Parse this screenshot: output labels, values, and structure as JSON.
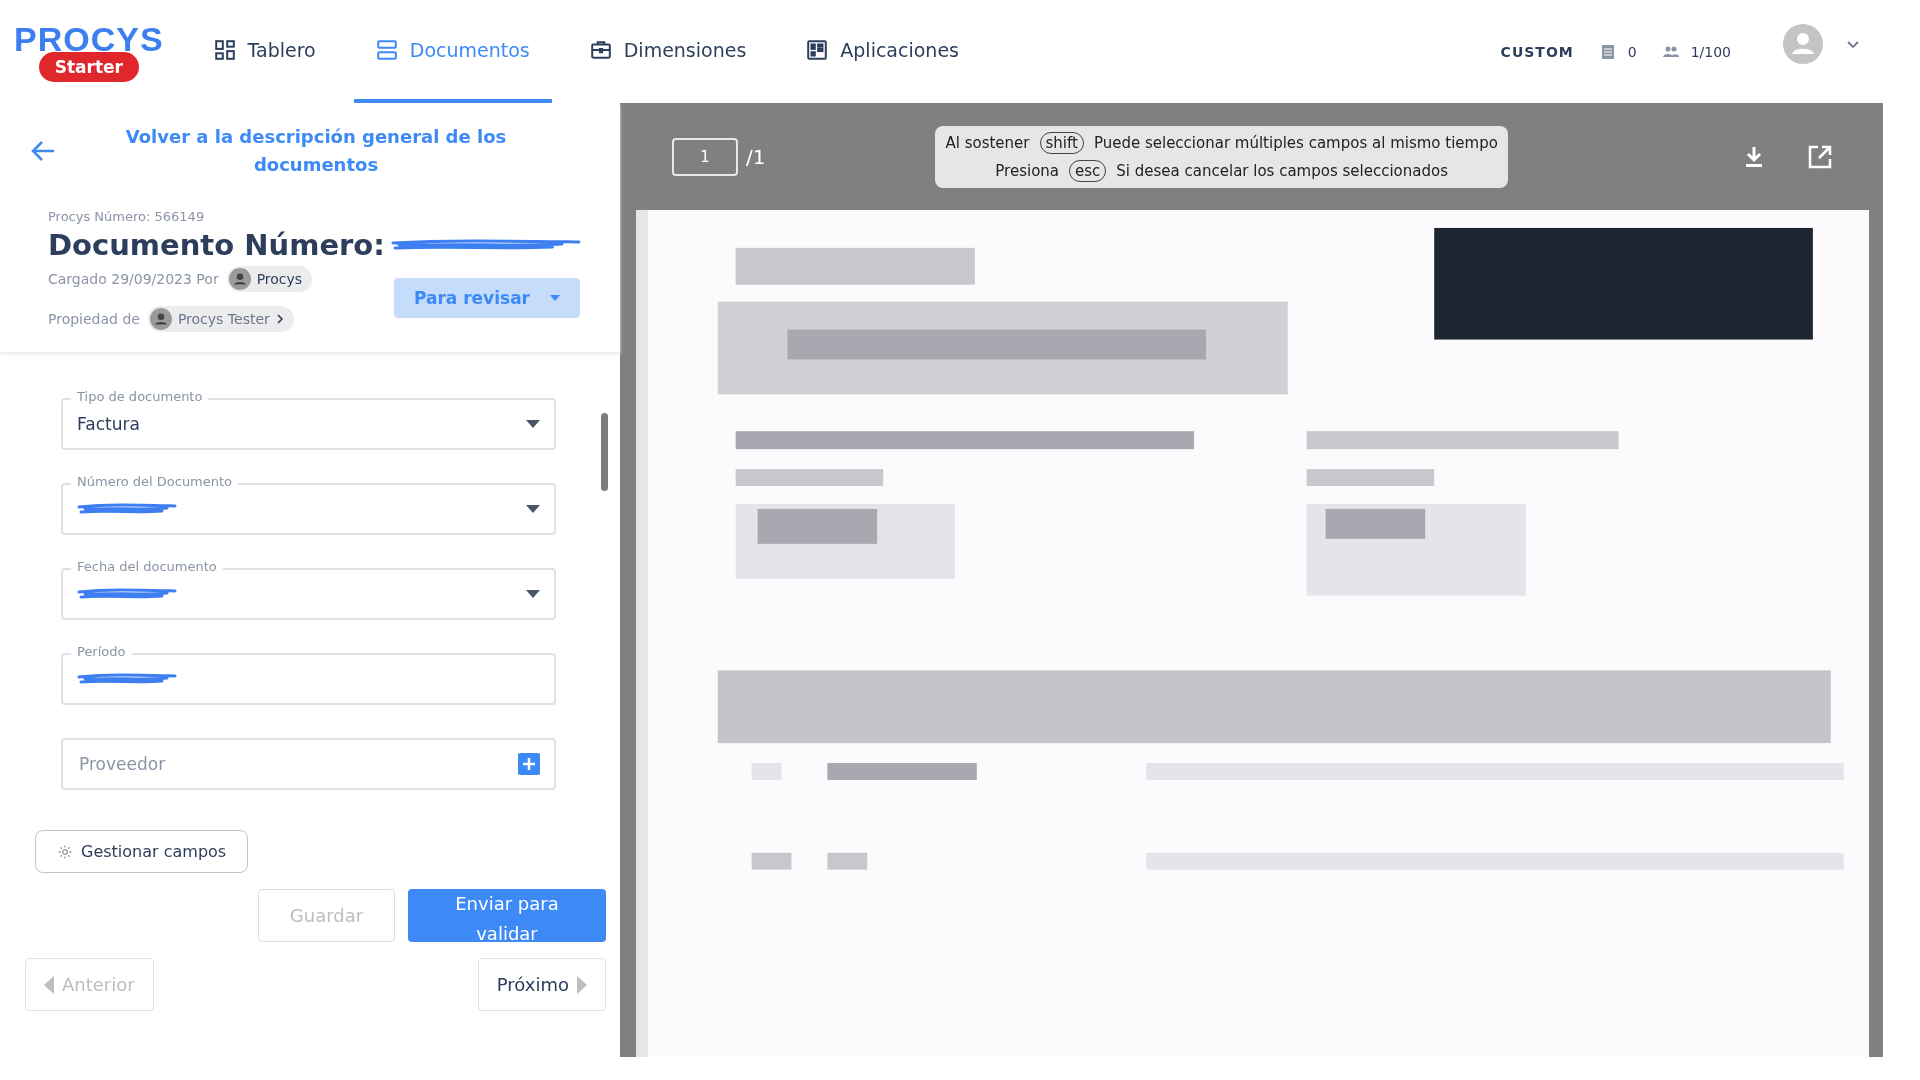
{
  "header": {
    "logo": "PROCYS",
    "plan_badge": "Starter",
    "nav": [
      {
        "label": "Tablero",
        "selected": false
      },
      {
        "label": "Documentos",
        "selected": true
      },
      {
        "label": "Dimensiones",
        "selected": false
      },
      {
        "label": "Aplicaciones",
        "selected": false
      }
    ],
    "plan": "CUSTOM",
    "doc_count": "0",
    "users": "1/100"
  },
  "left": {
    "back_link": "Volver a la descripción general de los documentos",
    "procys_number": "Procys Número: 566149",
    "title": "Documento Número:",
    "title_redacted": true,
    "uploaded": "Cargado 29/09/2023 Por",
    "uploader": "Procys",
    "owner_label": "Propiedad de",
    "owner": "Procys Tester",
    "status_button": "Para revisar",
    "fields": [
      {
        "kind": "select",
        "label": "Tipo de documento",
        "value": "Factura",
        "redacted": false
      },
      {
        "kind": "select",
        "label": "Número del Documento",
        "redacted": true
      },
      {
        "kind": "select",
        "label": "Fecha del documento",
        "redacted": true
      },
      {
        "kind": "text",
        "label": "Período",
        "redacted": true
      },
      {
        "kind": "add",
        "placeholder": "Proveedor"
      }
    ],
    "manage_button": "Gestionar campos",
    "save_button": {
      "label": "Guardar",
      "disabled": true
    },
    "submit_button": "Enviar para validar",
    "prev_button": {
      "label": "Anterior",
      "disabled": true
    },
    "next_button": {
      "label": "Próximo",
      "disabled": false
    }
  },
  "viewer": {
    "page": "1",
    "page_total": "/1",
    "hint_lines": [
      {
        "before": "Al sostener",
        "key": "shift",
        "after": "Puede seleccionar múltiples campos al mismo tiempo"
      },
      {
        "before": "Presiona",
        "key": "esc",
        "after": "Si desea cancelar los campos seleccionados"
      }
    ]
  }
}
